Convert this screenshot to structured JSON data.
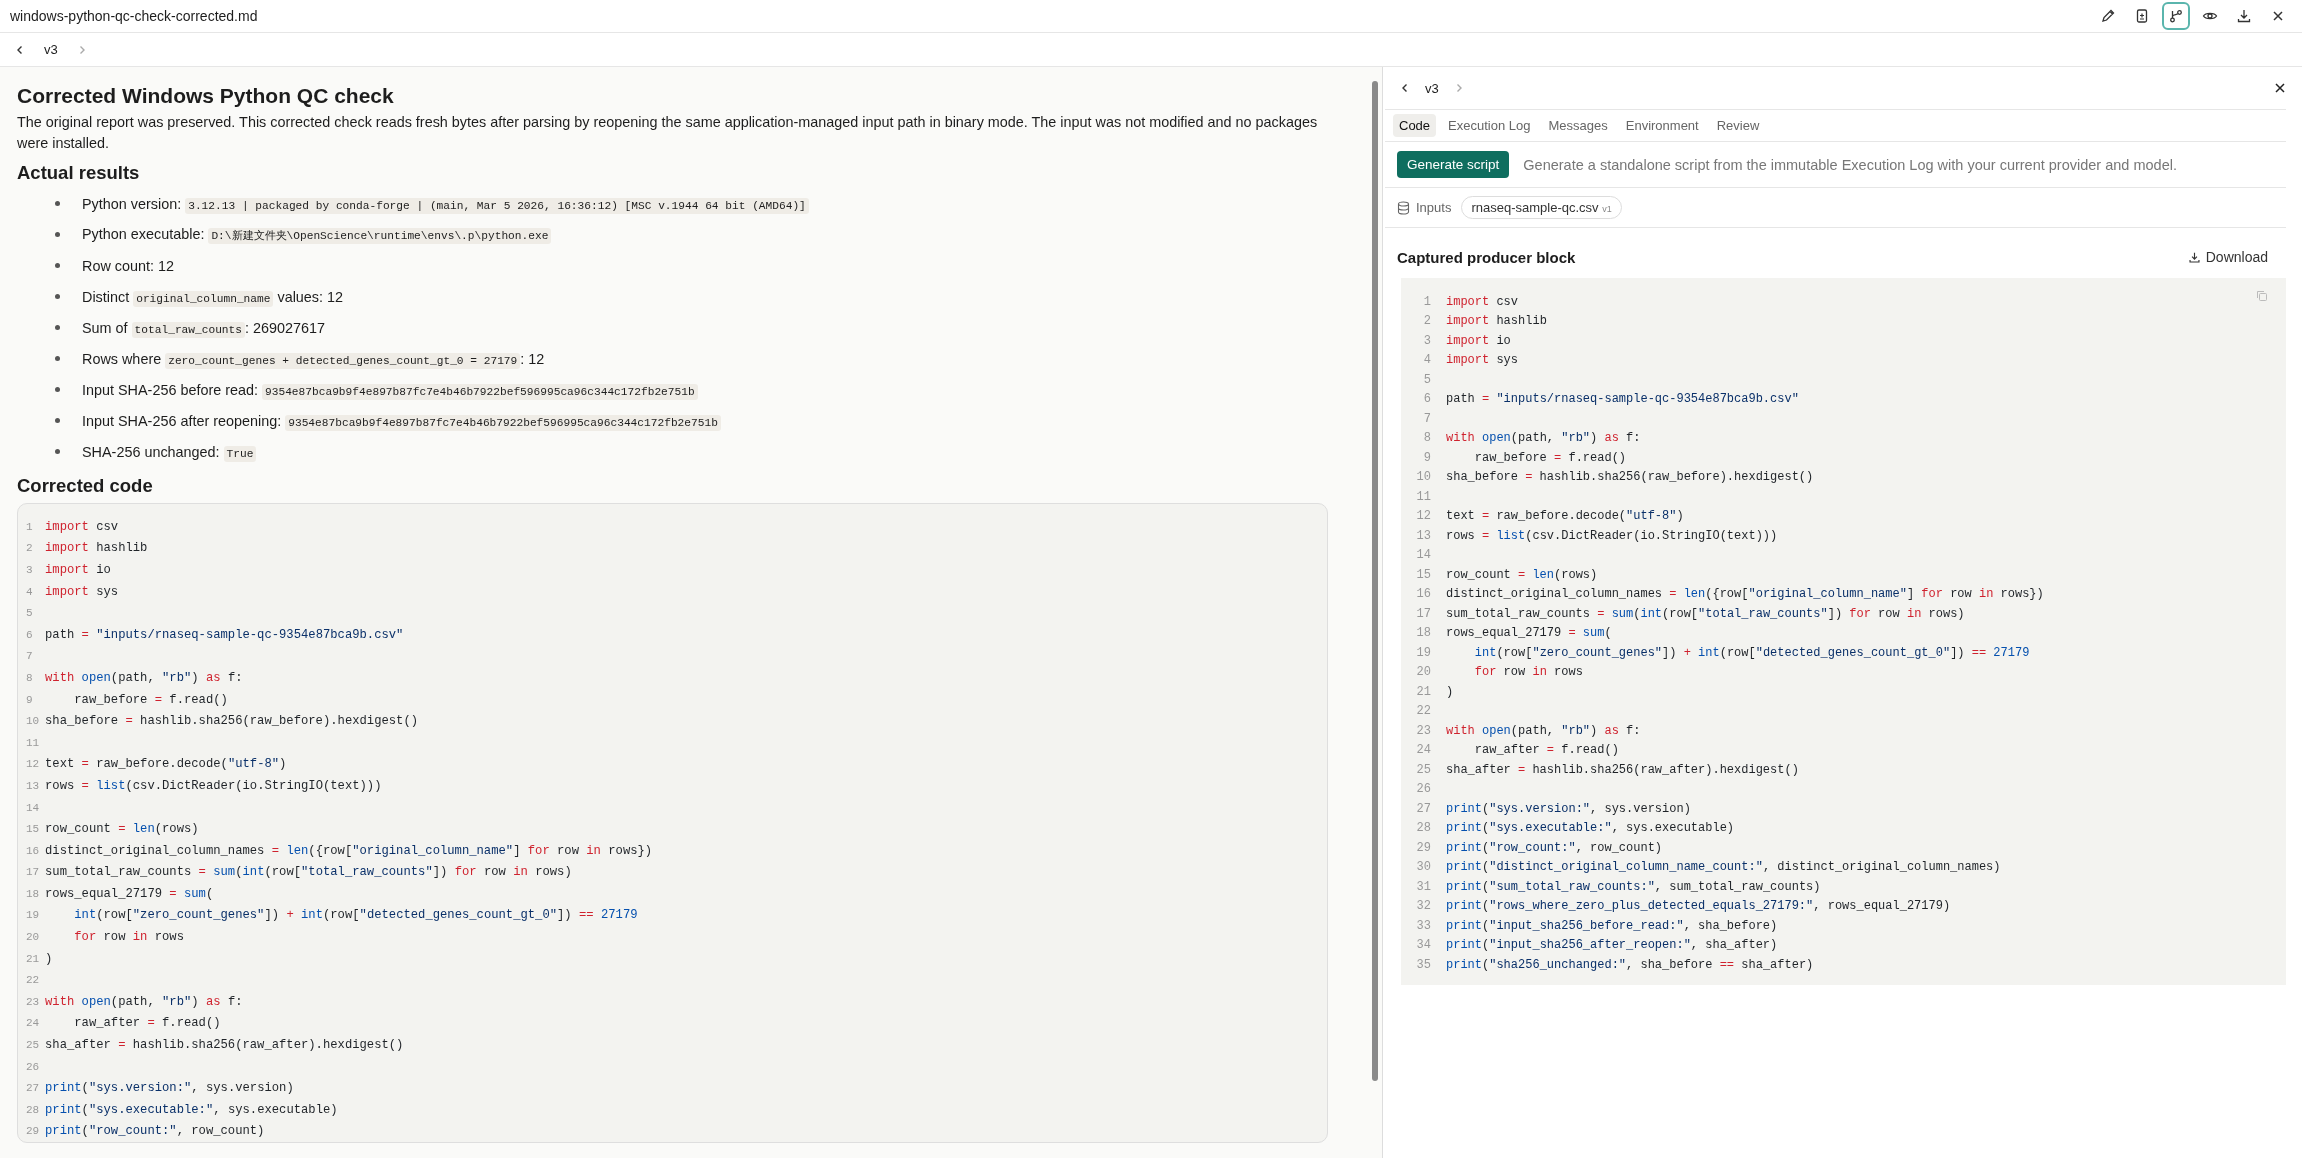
{
  "window": {
    "title": "windows-python-qc-check-corrected.md"
  },
  "toolbar": [
    {
      "selected": false
    },
    {
      "selected": false
    },
    {
      "selected": true
    },
    {
      "selected": false
    },
    {
      "selected": false
    },
    {
      "selected": false
    }
  ],
  "version_nav": {
    "label": "v3"
  },
  "document": {
    "title": "Corrected Windows Python QC check",
    "intro": "The original report was preserved. This corrected check reads fresh bytes after parsing by reopening the same application-managed input path in binary mode. The input was not modified and no packages were installed.",
    "results_heading": "Actual results",
    "results": [
      {
        "parts": [
          {
            "kind": "text",
            "t": "Python version: "
          },
          {
            "kind": "code",
            "t": "3.12.13 | packaged by conda-forge | (main, Mar  5 2026, 16:36:12) [MSC v.1944 64 bit (AMD64)]"
          }
        ]
      },
      {
        "parts": [
          {
            "kind": "text",
            "t": "Python executable: "
          },
          {
            "kind": "code",
            "t": "D:\\新建文件夹\\OpenScience\\runtime\\envs\\.p\\python.exe"
          }
        ]
      },
      {
        "parts": [
          {
            "kind": "text",
            "t": "Row count: 12"
          }
        ]
      },
      {
        "parts": [
          {
            "kind": "text",
            "t": "Distinct "
          },
          {
            "kind": "code",
            "t": "original_column_name"
          },
          {
            "kind": "text",
            "t": " values: 12"
          }
        ]
      },
      {
        "parts": [
          {
            "kind": "text",
            "t": "Sum of "
          },
          {
            "kind": "code",
            "t": "total_raw_counts"
          },
          {
            "kind": "text",
            "t": ": 269027617"
          }
        ]
      },
      {
        "parts": [
          {
            "kind": "text",
            "t": "Rows where "
          },
          {
            "kind": "code",
            "t": "zero_count_genes + detected_genes_count_gt_0 = 27179"
          },
          {
            "kind": "text",
            "t": ": 12"
          }
        ]
      },
      {
        "parts": [
          {
            "kind": "text",
            "t": "Input SHA-256 before read: "
          },
          {
            "kind": "code",
            "t": "9354e87bca9b9f4e897b87fc7e4b46b7922bef596995ca96c344c172fb2e751b"
          }
        ]
      },
      {
        "parts": [
          {
            "kind": "text",
            "t": "Input SHA-256 after reopening: "
          },
          {
            "kind": "code",
            "t": "9354e87bca9b9f4e897b87fc7e4b46b7922bef596995ca96c344c172fb2e751b"
          }
        ]
      },
      {
        "parts": [
          {
            "kind": "text",
            "t": "SHA-256 unchanged: "
          },
          {
            "kind": "code",
            "t": "True"
          }
        ]
      }
    ],
    "code_heading": "Corrected code",
    "code": [
      {
        "n": "1",
        "parts": [
          {
            "kind": "kw",
            "text": "import"
          },
          {
            "kind": "txt",
            "text": " csv"
          }
        ]
      },
      {
        "n": "2",
        "parts": [
          {
            "kind": "kw",
            "text": "import"
          },
          {
            "kind": "txt",
            "text": " hashlib"
          }
        ]
      },
      {
        "n": "3",
        "parts": [
          {
            "kind": "kw",
            "text": "import"
          },
          {
            "kind": "txt",
            "text": " io"
          }
        ]
      },
      {
        "n": "4",
        "parts": [
          {
            "kind": "kw",
            "text": "import"
          },
          {
            "kind": "txt",
            "text": " sys"
          }
        ]
      },
      {
        "n": "5"
      },
      {
        "n": "6",
        "parts": [
          {
            "kind": "txt",
            "text": "path "
          },
          {
            "kind": "op",
            "text": "= "
          },
          {
            "kind": "str",
            "text": "\"inputs/rnaseq-sample-qc-9354e87bca9b.csv\""
          }
        ]
      },
      {
        "n": "7"
      },
      {
        "n": "8",
        "parts": [
          {
            "kind": "kw",
            "text": "with"
          },
          {
            "kind": "fn",
            "text": " open"
          },
          {
            "kind": "txt",
            "text": "(path, "
          },
          {
            "kind": "str",
            "text": "\"rb\""
          },
          {
            "kind": "txt",
            "text": ") "
          },
          {
            "kind": "kw",
            "text": "as"
          },
          {
            "kind": "txt",
            "text": " f:"
          }
        ]
      },
      {
        "n": "9",
        "parts": [
          {
            "kind": "txt",
            "text": "    raw_before "
          },
          {
            "kind": "op",
            "text": "="
          },
          {
            "kind": "txt",
            "text": " f.read()"
          }
        ]
      },
      {
        "n": "10",
        "parts": [
          {
            "kind": "txt",
            "text": "sha_before "
          },
          {
            "kind": "op",
            "text": "="
          },
          {
            "kind": "txt",
            "text": " hashlib.sha256(raw_before).hexdigest()"
          }
        ]
      },
      {
        "n": "11"
      },
      {
        "n": "12",
        "parts": [
          {
            "kind": "txt",
            "text": "text "
          },
          {
            "kind": "op",
            "text": "="
          },
          {
            "kind": "txt",
            "text": " raw_before.decode("
          },
          {
            "kind": "str",
            "text": "\"utf-8\""
          },
          {
            "kind": "txt",
            "text": ")"
          }
        ]
      },
      {
        "n": "13",
        "parts": [
          {
            "kind": "txt",
            "text": "rows "
          },
          {
            "kind": "op",
            "text": "= "
          },
          {
            "kind": "fn",
            "text": "list"
          },
          {
            "kind": "txt",
            "text": "(csv.DictReader(io.StringIO(text)))"
          }
        ]
      },
      {
        "n": "14"
      },
      {
        "n": "15",
        "parts": [
          {
            "kind": "txt",
            "text": "row_count "
          },
          {
            "kind": "op",
            "text": "= "
          },
          {
            "kind": "fn",
            "text": "len"
          },
          {
            "kind": "txt",
            "text": "(rows)"
          }
        ]
      },
      {
        "n": "16",
        "parts": [
          {
            "kind": "txt",
            "text": "distinct_original_column_names "
          },
          {
            "kind": "op",
            "text": "= "
          },
          {
            "kind": "fn",
            "text": "len"
          },
          {
            "kind": "txt",
            "text": "({row["
          },
          {
            "kind": "str",
            "text": "\"original_column_name\""
          },
          {
            "kind": "txt",
            "text": "] "
          },
          {
            "kind": "kw",
            "text": "for"
          },
          {
            "kind": "txt",
            "text": " row "
          },
          {
            "kind": "kw",
            "text": "in"
          },
          {
            "kind": "txt",
            "text": " rows})"
          }
        ]
      },
      {
        "n": "17",
        "parts": [
          {
            "kind": "txt",
            "text": "sum_total_raw_counts "
          },
          {
            "kind": "op",
            "text": "= "
          },
          {
            "kind": "fn",
            "text": "sum"
          },
          {
            "kind": "txt",
            "text": "("
          },
          {
            "kind": "fn",
            "text": "int"
          },
          {
            "kind": "txt",
            "text": "(row["
          },
          {
            "kind": "str",
            "text": "\"total_raw_counts\""
          },
          {
            "kind": "txt",
            "text": "]) "
          },
          {
            "kind": "kw",
            "text": "for"
          },
          {
            "kind": "txt",
            "text": " row "
          },
          {
            "kind": "kw",
            "text": "in"
          },
          {
            "kind": "txt",
            "text": " rows)"
          }
        ]
      },
      {
        "n": "18",
        "parts": [
          {
            "kind": "txt",
            "text": "rows_equal_27179 "
          },
          {
            "kind": "op",
            "text": "= "
          },
          {
            "kind": "fn",
            "text": "sum"
          },
          {
            "kind": "txt",
            "text": "("
          }
        ]
      },
      {
        "n": "19",
        "parts": [
          {
            "kind": "fn",
            "text": "    int"
          },
          {
            "kind": "txt",
            "text": "(row["
          },
          {
            "kind": "str",
            "text": "\"zero_count_genes\""
          },
          {
            "kind": "txt",
            "text": "]) "
          },
          {
            "kind": "op",
            "text": "+ "
          },
          {
            "kind": "fn",
            "text": "int"
          },
          {
            "kind": "txt",
            "text": "(row["
          },
          {
            "kind": "str",
            "text": "\"detected_genes_count_gt_0\""
          },
          {
            "kind": "txt",
            "text": "]) "
          },
          {
            "kind": "op",
            "text": "== "
          },
          {
            "kind": "num",
            "text": "27179"
          }
        ]
      },
      {
        "n": "20",
        "parts": [
          {
            "kind": "kw",
            "text": "    for"
          },
          {
            "kind": "txt",
            "text": " row "
          },
          {
            "kind": "kw",
            "text": "in"
          },
          {
            "kind": "txt",
            "text": " rows"
          }
        ]
      },
      {
        "n": "21",
        "parts": [
          {
            "kind": "txt",
            "text": ")"
          }
        ]
      },
      {
        "n": "22"
      },
      {
        "n": "23",
        "parts": [
          {
            "kind": "kw",
            "text": "with"
          },
          {
            "kind": "fn",
            "text": " open"
          },
          {
            "kind": "txt",
            "text": "(path, "
          },
          {
            "kind": "str",
            "text": "\"rb\""
          },
          {
            "kind": "txt",
            "text": ") "
          },
          {
            "kind": "kw",
            "text": "as"
          },
          {
            "kind": "txt",
            "text": " f:"
          }
        ]
      },
      {
        "n": "24",
        "parts": [
          {
            "kind": "txt",
            "text": "    raw_after "
          },
          {
            "kind": "op",
            "text": "="
          },
          {
            "kind": "txt",
            "text": " f.read()"
          }
        ]
      },
      {
        "n": "25",
        "parts": [
          {
            "kind": "txt",
            "text": "sha_after "
          },
          {
            "kind": "op",
            "text": "="
          },
          {
            "kind": "txt",
            "text": " hashlib.sha256(raw_after).hexdigest()"
          }
        ]
      },
      {
        "n": "26"
      },
      {
        "n": "27",
        "parts": [
          {
            "kind": "fn",
            "text": "print"
          },
          {
            "kind": "txt",
            "text": "("
          },
          {
            "kind": "str",
            "text": "\"sys.version:\""
          },
          {
            "kind": "txt",
            "text": ", sys.version)"
          }
        ]
      },
      {
        "n": "28",
        "parts": [
          {
            "kind": "fn",
            "text": "print"
          },
          {
            "kind": "txt",
            "text": "("
          },
          {
            "kind": "str",
            "text": "\"sys.executable:\""
          },
          {
            "kind": "txt",
            "text": ", sys.executable)"
          }
        ]
      },
      {
        "n": "29",
        "parts": [
          {
            "kind": "fn",
            "text": "print"
          },
          {
            "kind": "txt",
            "text": "("
          },
          {
            "kind": "str",
            "text": "\"row_count:\""
          },
          {
            "kind": "txt",
            "text": ", row_count)"
          }
        ]
      }
    ]
  },
  "side_panel": {
    "version_nav": {
      "label": "v3"
    },
    "tabs": [
      {
        "label": "Code",
        "selected": true
      },
      {
        "label": "Execution Log",
        "selected": false
      },
      {
        "label": "Messages",
        "selected": false
      },
      {
        "label": "Environment",
        "selected": false
      },
      {
        "label": "Review",
        "selected": false
      }
    ],
    "generate_button": "Generate script",
    "generate_hint": "Generate a standalone script from the immutable Execution Log with your current provider and model.",
    "inputs_label": "Inputs",
    "input_chip": {
      "name": "rnaseq-sample-qc.csv",
      "version": "v1"
    },
    "block_title": "Captured producer block",
    "download": "Download",
    "code": [
      {
        "n": "1",
        "parts": [
          {
            "kind": "kw",
            "text": "import"
          },
          {
            "kind": "txt",
            "text": " csv"
          }
        ]
      },
      {
        "n": "2",
        "parts": [
          {
            "kind": "kw",
            "text": "import"
          },
          {
            "kind": "txt",
            "text": " hashlib"
          }
        ]
      },
      {
        "n": "3",
        "parts": [
          {
            "kind": "kw",
            "text": "import"
          },
          {
            "kind": "txt",
            "text": " io"
          }
        ]
      },
      {
        "n": "4",
        "parts": [
          {
            "kind": "kw",
            "text": "import"
          },
          {
            "kind": "txt",
            "text": " sys"
          }
        ]
      },
      {
        "n": "5"
      },
      {
        "n": "6",
        "parts": [
          {
            "kind": "txt",
            "text": "path "
          },
          {
            "kind": "op",
            "text": "= "
          },
          {
            "kind": "str",
            "text": "\"inputs/rnaseq-sample-qc-9354e87bca9b.csv\""
          }
        ]
      },
      {
        "n": "7"
      },
      {
        "n": "8",
        "parts": [
          {
            "kind": "kw",
            "text": "with"
          },
          {
            "kind": "fn",
            "text": " open"
          },
          {
            "kind": "txt",
            "text": "(path, "
          },
          {
            "kind": "str",
            "text": "\"rb\""
          },
          {
            "kind": "txt",
            "text": ") "
          },
          {
            "kind": "kw",
            "text": "as"
          },
          {
            "kind": "txt",
            "text": " f:"
          }
        ]
      },
      {
        "n": "9",
        "parts": [
          {
            "kind": "txt",
            "text": "    raw_before "
          },
          {
            "kind": "op",
            "text": "="
          },
          {
            "kind": "txt",
            "text": " f.read()"
          }
        ]
      },
      {
        "n": "10",
        "parts": [
          {
            "kind": "txt",
            "text": "sha_before "
          },
          {
            "kind": "op",
            "text": "="
          },
          {
            "kind": "txt",
            "text": " hashlib.sha256(raw_before).hexdigest()"
          }
        ]
      },
      {
        "n": "11"
      },
      {
        "n": "12",
        "parts": [
          {
            "kind": "txt",
            "text": "text "
          },
          {
            "kind": "op",
            "text": "="
          },
          {
            "kind": "txt",
            "text": " raw_before.decode("
          },
          {
            "kind": "str",
            "text": "\"utf-8\""
          },
          {
            "kind": "txt",
            "text": ")"
          }
        ]
      },
      {
        "n": "13",
        "parts": [
          {
            "kind": "txt",
            "text": "rows "
          },
          {
            "kind": "op",
            "text": "= "
          },
          {
            "kind": "fn",
            "text": "list"
          },
          {
            "kind": "txt",
            "text": "(csv.DictReader(io.StringIO(text)))"
          }
        ]
      },
      {
        "n": "14"
      },
      {
        "n": "15",
        "parts": [
          {
            "kind": "txt",
            "text": "row_count "
          },
          {
            "kind": "op",
            "text": "= "
          },
          {
            "kind": "fn",
            "text": "len"
          },
          {
            "kind": "txt",
            "text": "(rows)"
          }
        ]
      },
      {
        "n": "16",
        "parts": [
          {
            "kind": "txt",
            "text": "distinct_original_column_names "
          },
          {
            "kind": "op",
            "text": "= "
          },
          {
            "kind": "fn",
            "text": "len"
          },
          {
            "kind": "txt",
            "text": "({row["
          },
          {
            "kind": "str",
            "text": "\"original_column_name\""
          },
          {
            "kind": "txt",
            "text": "] "
          },
          {
            "kind": "kw",
            "text": "for"
          },
          {
            "kind": "txt",
            "text": " row "
          },
          {
            "kind": "kw",
            "text": "in"
          },
          {
            "kind": "txt",
            "text": " rows})"
          }
        ]
      },
      {
        "n": "17",
        "parts": [
          {
            "kind": "txt",
            "text": "sum_total_raw_counts "
          },
          {
            "kind": "op",
            "text": "= "
          },
          {
            "kind": "fn",
            "text": "sum"
          },
          {
            "kind": "txt",
            "text": "("
          },
          {
            "kind": "fn",
            "text": "int"
          },
          {
            "kind": "txt",
            "text": "(row["
          },
          {
            "kind": "str",
            "text": "\"total_raw_counts\""
          },
          {
            "kind": "txt",
            "text": "]) "
          },
          {
            "kind": "kw",
            "text": "for"
          },
          {
            "kind": "txt",
            "text": " row "
          },
          {
            "kind": "kw",
            "text": "in"
          },
          {
            "kind": "txt",
            "text": " rows)"
          }
        ]
      },
      {
        "n": "18",
        "parts": [
          {
            "kind": "txt",
            "text": "rows_equal_27179 "
          },
          {
            "kind": "op",
            "text": "= "
          },
          {
            "kind": "fn",
            "text": "sum"
          },
          {
            "kind": "txt",
            "text": "("
          }
        ]
      },
      {
        "n": "19",
        "parts": [
          {
            "kind": "fn",
            "text": "    int"
          },
          {
            "kind": "txt",
            "text": "(row["
          },
          {
            "kind": "str",
            "text": "\"zero_count_genes\""
          },
          {
            "kind": "txt",
            "text": "]) "
          },
          {
            "kind": "op",
            "text": "+ "
          },
          {
            "kind": "fn",
            "text": "int"
          },
          {
            "kind": "txt",
            "text": "(row["
          },
          {
            "kind": "str",
            "text": "\"detected_genes_count_gt_0\""
          },
          {
            "kind": "txt",
            "text": "]) "
          },
          {
            "kind": "op",
            "text": "== "
          },
          {
            "kind": "num",
            "text": "27179"
          }
        ]
      },
      {
        "n": "20",
        "parts": [
          {
            "kind": "kw",
            "text": "    for"
          },
          {
            "kind": "txt",
            "text": " row "
          },
          {
            "kind": "kw",
            "text": "in"
          },
          {
            "kind": "txt",
            "text": " rows"
          }
        ]
      },
      {
        "n": "21",
        "parts": [
          {
            "kind": "txt",
            "text": ")"
          }
        ]
      },
      {
        "n": "22"
      },
      {
        "n": "23",
        "parts": [
          {
            "kind": "kw",
            "text": "with"
          },
          {
            "kind": "fn",
            "text": " open"
          },
          {
            "kind": "txt",
            "text": "(path, "
          },
          {
            "kind": "str",
            "text": "\"rb\""
          },
          {
            "kind": "txt",
            "text": ") "
          },
          {
            "kind": "kw",
            "text": "as"
          },
          {
            "kind": "txt",
            "text": " f:"
          }
        ]
      },
      {
        "n": "24",
        "parts": [
          {
            "kind": "txt",
            "text": "    raw_after "
          },
          {
            "kind": "op",
            "text": "="
          },
          {
            "kind": "txt",
            "text": " f.read()"
          }
        ]
      },
      {
        "n": "25",
        "parts": [
          {
            "kind": "txt",
            "text": "sha_after "
          },
          {
            "kind": "op",
            "text": "="
          },
          {
            "kind": "txt",
            "text": " hashlib.sha256(raw_after).hexdigest()"
          }
        ]
      },
      {
        "n": "26"
      },
      {
        "n": "27",
        "parts": [
          {
            "kind": "fn",
            "text": "print"
          },
          {
            "kind": "txt",
            "text": "("
          },
          {
            "kind": "str",
            "text": "\"sys.version:\""
          },
          {
            "kind": "txt",
            "text": ", sys.version)"
          }
        ]
      },
      {
        "n": "28",
        "parts": [
          {
            "kind": "fn",
            "text": "print"
          },
          {
            "kind": "txt",
            "text": "("
          },
          {
            "kind": "str",
            "text": "\"sys.executable:\""
          },
          {
            "kind": "txt",
            "text": ", sys.executable)"
          }
        ]
      },
      {
        "n": "29",
        "parts": [
          {
            "kind": "fn",
            "text": "print"
          },
          {
            "kind": "txt",
            "text": "("
          },
          {
            "kind": "str",
            "text": "\"row_count:\""
          },
          {
            "kind": "txt",
            "text": ", row_count)"
          }
        ]
      },
      {
        "n": "30",
        "parts": [
          {
            "kind": "fn",
            "text": "print"
          },
          {
            "kind": "txt",
            "text": "("
          },
          {
            "kind": "str",
            "text": "\"distinct_original_column_name_count:\""
          },
          {
            "kind": "txt",
            "text": ", distinct_original_column_names)"
          }
        ]
      },
      {
        "n": "31",
        "parts": [
          {
            "kind": "fn",
            "text": "print"
          },
          {
            "kind": "txt",
            "text": "("
          },
          {
            "kind": "str",
            "text": "\"sum_total_raw_counts:\""
          },
          {
            "kind": "txt",
            "text": ", sum_total_raw_counts)"
          }
        ]
      },
      {
        "n": "32",
        "parts": [
          {
            "kind": "fn",
            "text": "print"
          },
          {
            "kind": "txt",
            "text": "("
          },
          {
            "kind": "str",
            "text": "\"rows_where_zero_plus_detected_equals_27179:\""
          },
          {
            "kind": "txt",
            "text": ", rows_equal_27179)"
          }
        ]
      },
      {
        "n": "33",
        "parts": [
          {
            "kind": "fn",
            "text": "print"
          },
          {
            "kind": "txt",
            "text": "("
          },
          {
            "kind": "str",
            "text": "\"input_sha256_before_read:\""
          },
          {
            "kind": "txt",
            "text": ", sha_before)"
          }
        ]
      },
      {
        "n": "34",
        "parts": [
          {
            "kind": "fn",
            "text": "print"
          },
          {
            "kind": "txt",
            "text": "("
          },
          {
            "kind": "str",
            "text": "\"input_sha256_after_reopen:\""
          },
          {
            "kind": "txt",
            "text": ", sha_after)"
          }
        ]
      },
      {
        "n": "35",
        "parts": [
          {
            "kind": "fn",
            "text": "print"
          },
          {
            "kind": "txt",
            "text": "("
          },
          {
            "kind": "str",
            "text": "\"sha256_unchanged:\""
          },
          {
            "kind": "txt",
            "text": ", sha_before "
          },
          {
            "kind": "op",
            "text": "=="
          },
          {
            "kind": "txt",
            "text": " sha_after)"
          }
        ]
      }
    ]
  }
}
